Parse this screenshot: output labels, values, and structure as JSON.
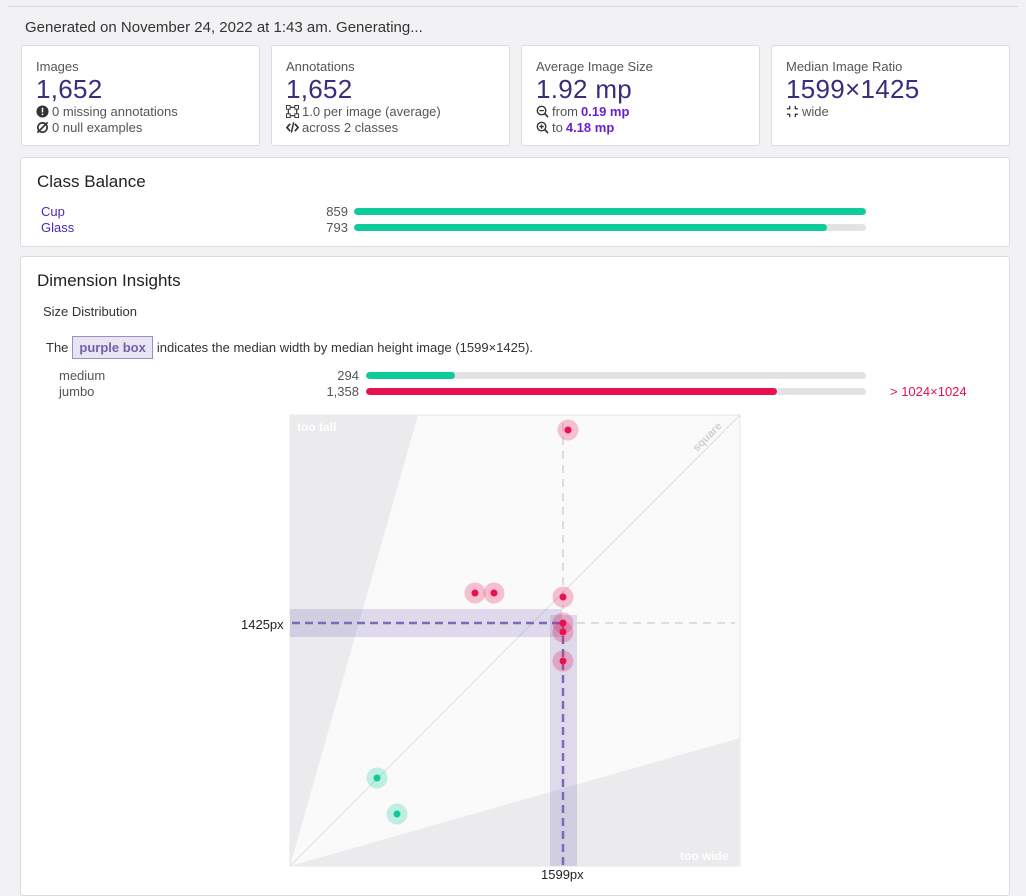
{
  "generated_text": "Generated on November 24, 2022 at 1:43 am. Generating...",
  "stats": {
    "images": {
      "label": "Images",
      "value": "1,652",
      "line1": "0 missing annotations",
      "line2": "0 null examples"
    },
    "annotations": {
      "label": "Annotations",
      "value": "1,652",
      "line1": "1.0 per image (average)",
      "line2": "across 2 classes"
    },
    "avg_size": {
      "label": "Average Image Size",
      "value": "1.92 mp",
      "line1_prefix": "from",
      "line1_value": "0.19 mp",
      "line2_prefix": "to",
      "line2_value": "4.18 mp"
    },
    "median_ratio": {
      "label": "Median Image Ratio",
      "value": "1599×1425",
      "line1": "wide"
    }
  },
  "class_balance": {
    "title": "Class Balance",
    "max": 859,
    "classes": [
      {
        "name": "Cup",
        "count": 859,
        "display": "859"
      },
      {
        "name": "Glass",
        "count": 793,
        "display": "793"
      }
    ]
  },
  "dimension_insights": {
    "title": "Dimension Insights",
    "subtitle": "Size Distribution",
    "legend_prefix": "The",
    "legend_box": "purple box",
    "legend_suffix": "indicates the median width by median height image (1599×1425).",
    "total": 1652,
    "sizes": [
      {
        "name": "medium",
        "count": 294,
        "display": "294",
        "color": "#0ecc9a"
      },
      {
        "name": "jumbo",
        "count": 1358,
        "display": "1,358",
        "color": "#e8114f",
        "note": "> 1024×1024"
      }
    ],
    "plot": {
      "label_too_tall": "too tall",
      "label_too_wide": "too wide",
      "label_square": "square",
      "median_w_label": "1599px",
      "median_h_label": "1425px"
    }
  },
  "colors": {
    "accent": "#3b2c7e",
    "link": "#4a2bb0",
    "teal": "#0ecc9a",
    "pink": "#e8114f",
    "median": "#7a6ab8"
  }
}
